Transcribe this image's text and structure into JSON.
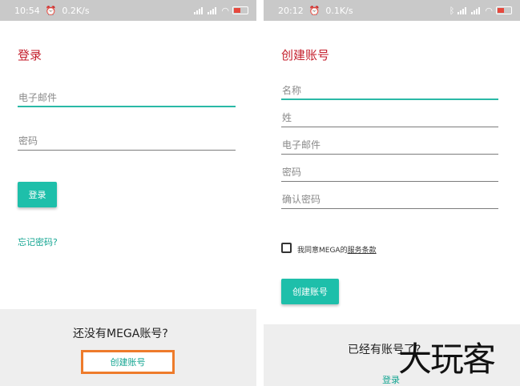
{
  "left": {
    "status": {
      "time": "10:54",
      "speed": "0.2K/s"
    },
    "title": "登录",
    "email_placeholder": "电子邮件",
    "password_placeholder": "密码",
    "login_button": "登录",
    "forgot_password": "忘记密码?",
    "no_account_prompt": "还没有MEGA账号?",
    "create_account_link": "创建账号"
  },
  "right": {
    "status": {
      "time": "20:12",
      "speed": "0.1K/s"
    },
    "title": "创建账号",
    "fields": [
      "名称",
      "姓",
      "电子邮件",
      "密码",
      "确认密码"
    ],
    "agree_prefix": "我同意MEGA的",
    "terms_link": "服务条款",
    "create_button": "创建账号",
    "has_account_prompt": "已经有账号了?",
    "login_link": "登录"
  },
  "watermark": "大玩客",
  "colors": {
    "accent": "#1ebfaa",
    "title_red": "#c41f2c",
    "highlight_orange": "#ee7b2b",
    "statusbar": "#c9c9c9"
  },
  "icons": [
    "alarm-icon",
    "signal-icon",
    "wifi-icon",
    "battery-icon",
    "bluetooth-icon"
  ]
}
